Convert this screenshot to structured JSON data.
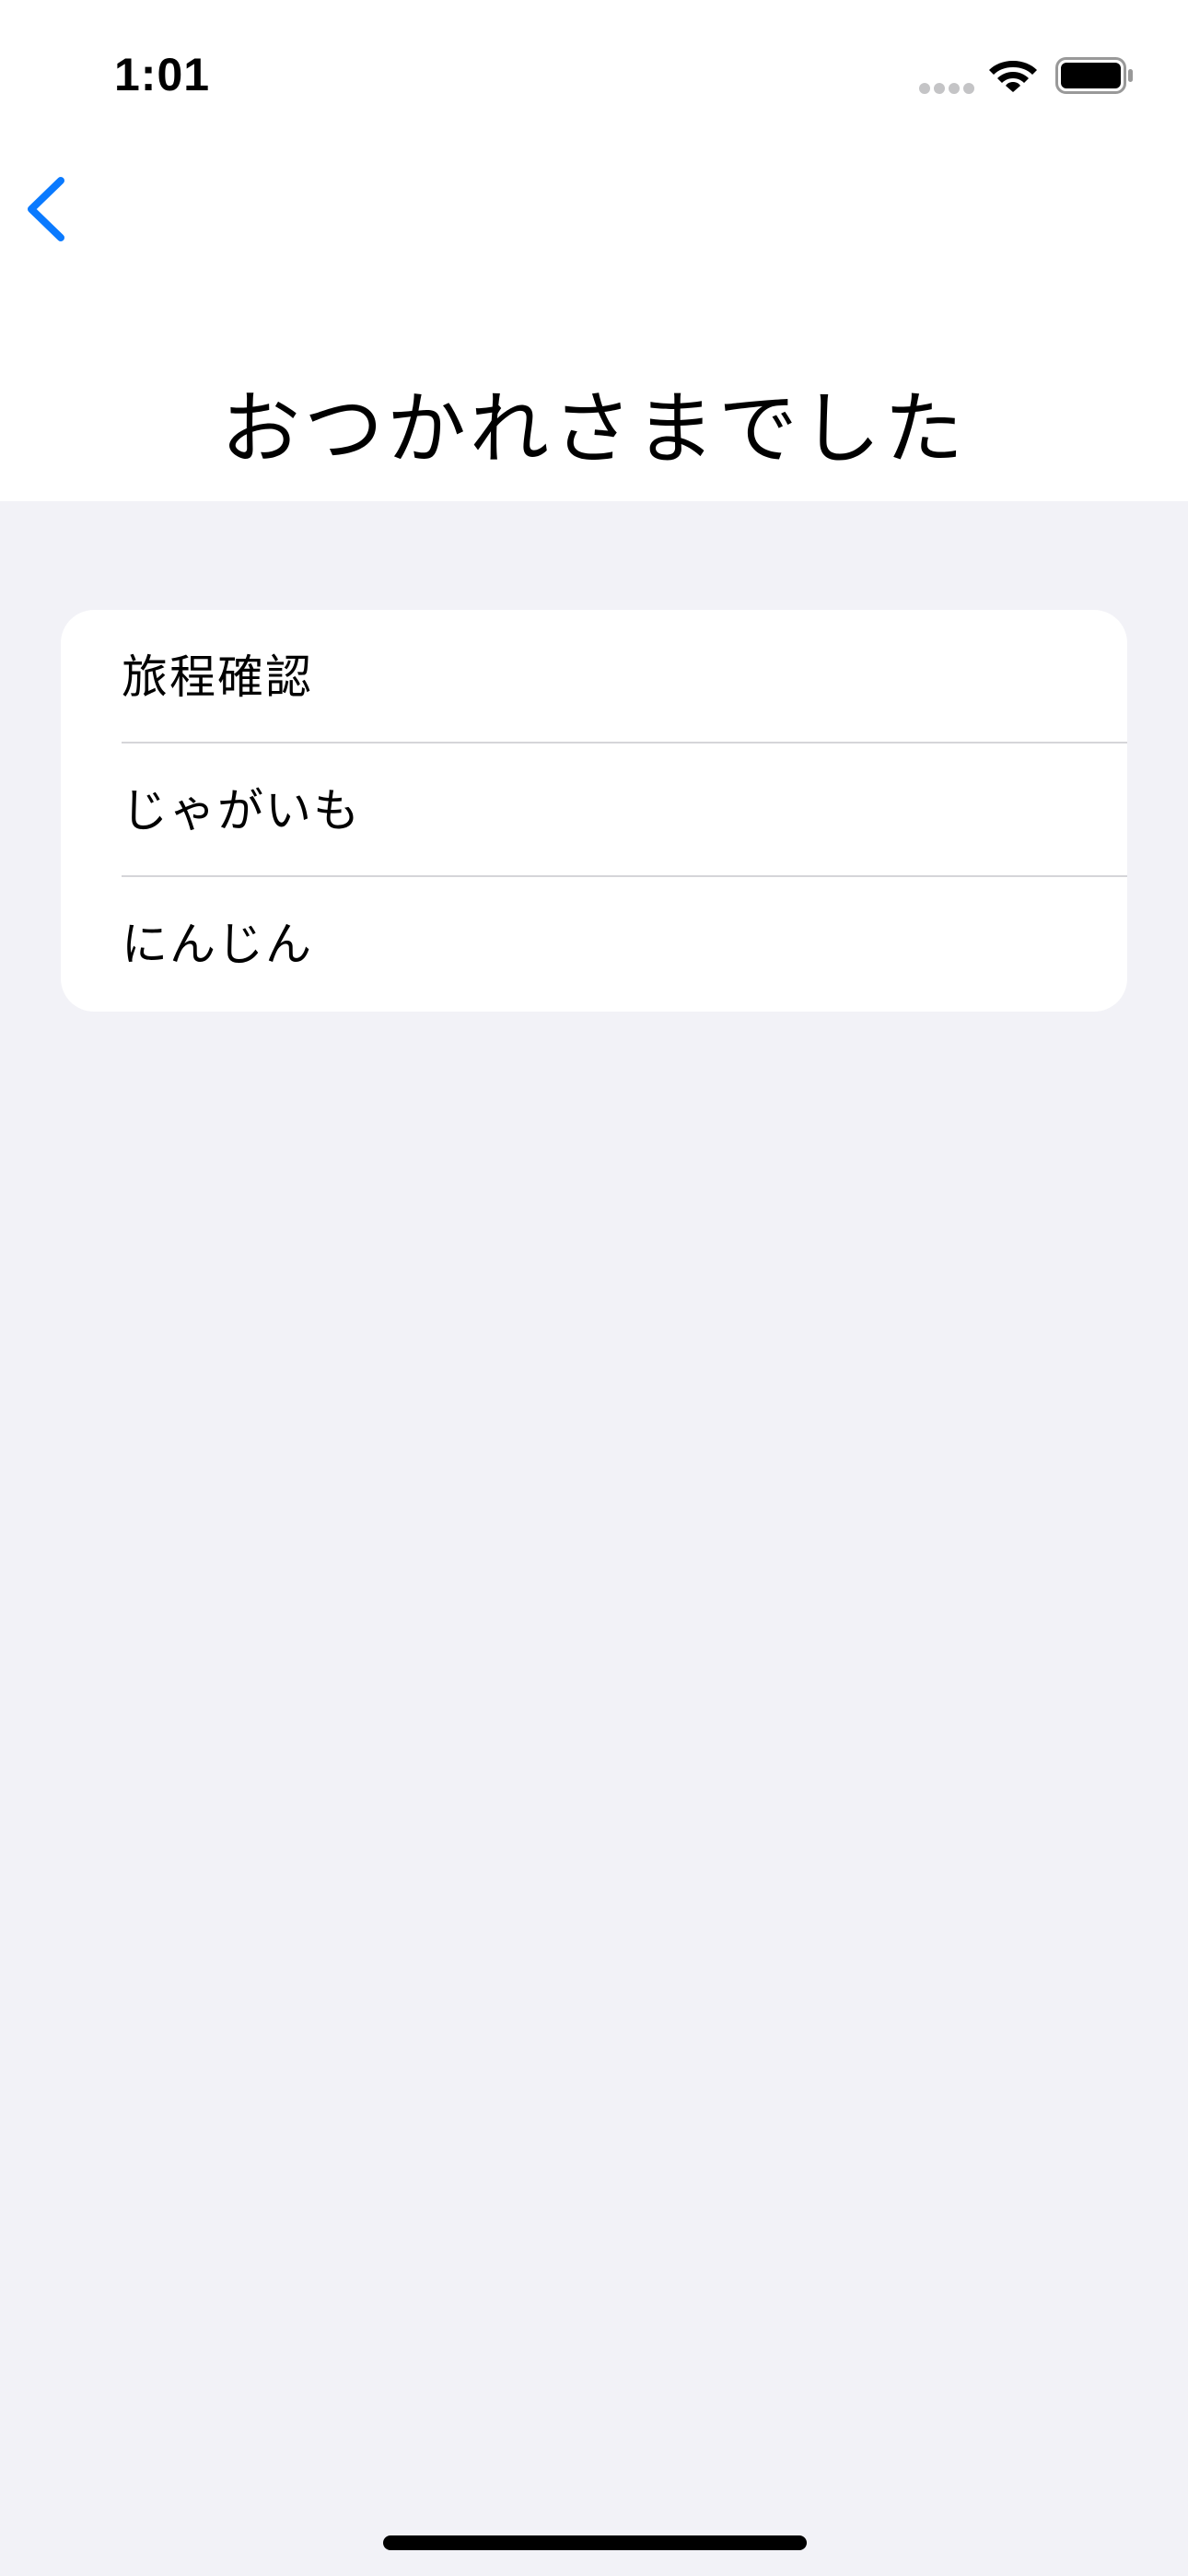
{
  "status_bar": {
    "time": "1:01",
    "signal_icon": "cellular-signal-icon",
    "wifi_icon": "wifi-icon",
    "battery_icon": "battery-full-icon"
  },
  "nav": {
    "back_icon": "chevron-left-icon",
    "accent_color": "#0a7aff"
  },
  "page": {
    "title": "おつかれさまでした"
  },
  "list": {
    "items": [
      {
        "label": "旅程確認"
      },
      {
        "label": "じゃがいも"
      },
      {
        "label": "にんじん"
      }
    ]
  },
  "colors": {
    "background": "#f2f2f7",
    "card": "#ffffff",
    "divider": "#d5d5d9"
  }
}
